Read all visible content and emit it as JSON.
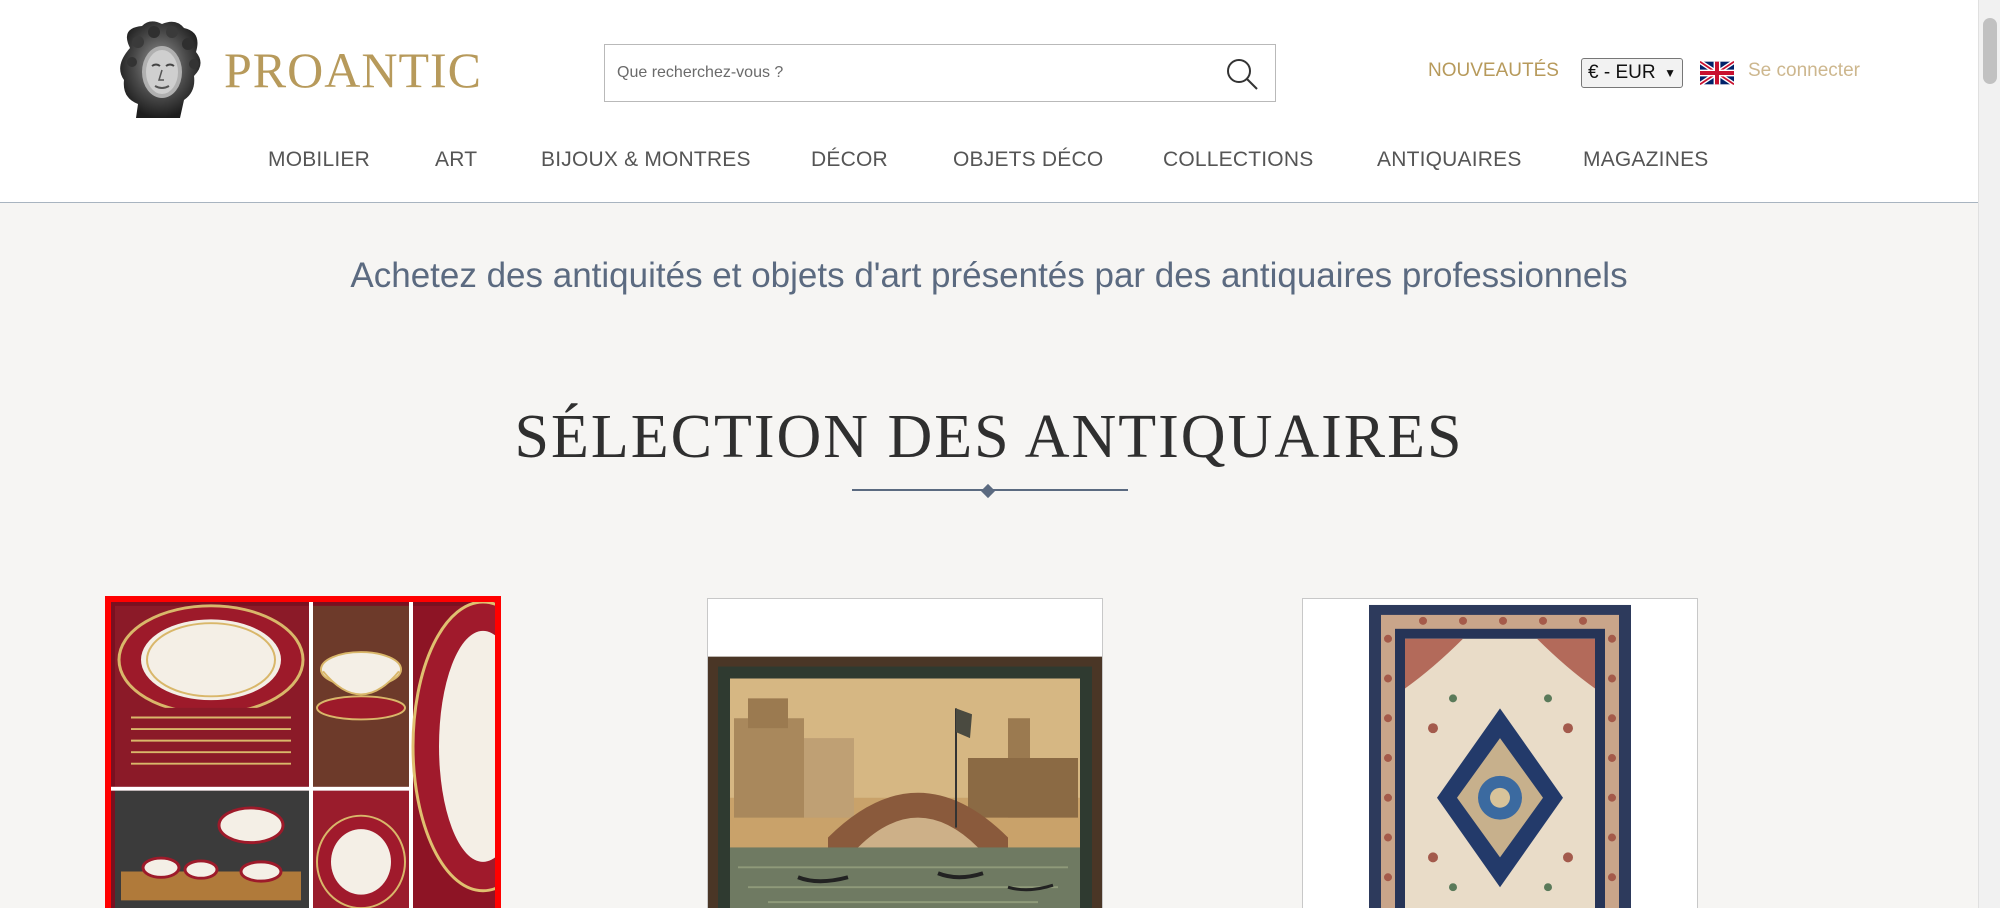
{
  "header": {
    "logo_text": "PROANTIC",
    "search_placeholder": "Que recherchez-vous ?",
    "new_label": "NOUVEAUTÉS",
    "currency_value": "€ - EUR",
    "language_flag": "uk-flag-icon",
    "login_label": "Se connecter"
  },
  "nav": {
    "items": [
      {
        "label": "MOBILIER"
      },
      {
        "label": "ART"
      },
      {
        "label": "BIJOUX & MONTRES"
      },
      {
        "label": "DÉCOR"
      },
      {
        "label": "OBJETS DÉCO"
      },
      {
        "label": "COLLECTIONS"
      },
      {
        "label": "ANTIQUAIRES"
      },
      {
        "label": "MAGAZINES"
      }
    ]
  },
  "main": {
    "tagline": "Achetez des antiquités et objets d'art présentés par des antiquaires professionnels",
    "section_title": "SÉLECTION DES ANTIQUAIRES"
  },
  "cards": [
    {
      "name": "porcelain-dinner-service",
      "selected": true
    },
    {
      "name": "venice-canal-painting",
      "selected": false
    },
    {
      "name": "persian-rug",
      "selected": false
    }
  ],
  "colors": {
    "brand_gold": "#b79a5b",
    "accent_blue": "#5b6a80",
    "selection_red": "#ff0000"
  }
}
